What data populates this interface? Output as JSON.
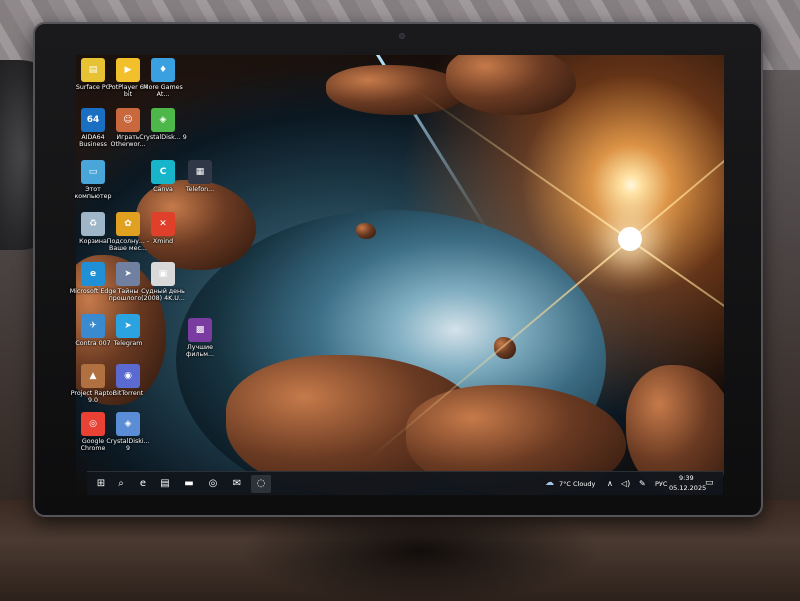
{
  "desktop_icons": [
    {
      "label": "Surface PC",
      "icon": "surface-pc-icon",
      "glyph": "▤",
      "color": "#e7c334"
    },
    {
      "label": "PotPlayer 64 bit",
      "icon": "potplayer-icon",
      "glyph": "▶",
      "color": "#f1c02a"
    },
    {
      "label": "More Games At...",
      "icon": "more-games-icon",
      "glyph": "♦",
      "color": "#3aa0e0"
    },
    {
      "label": "AIDA64 Business",
      "icon": "aida64-icon",
      "glyph": "64",
      "color": "#1a6fc2"
    },
    {
      "label": "Играть Otherwor...",
      "icon": "otherworld-game-icon",
      "glyph": "☺",
      "color": "#c8683c"
    },
    {
      "label": "CrystalDisk... 9",
      "icon": "crystaldisk-icon",
      "glyph": "◈",
      "color": "#4db74a"
    },
    {
      "label": "Этот компьютер",
      "icon": "this-pc-icon",
      "glyph": "▭",
      "color": "#4aa6d8"
    },
    {
      "label": "Canva",
      "icon": "canva-icon",
      "glyph": "C",
      "color": "#17b5c9"
    },
    {
      "label": "Telefon...",
      "icon": "telefon-icon",
      "glyph": "▦",
      "color": "#303848"
    },
    {
      "label": "Корзина",
      "icon": "recycle-bin-icon",
      "glyph": "♻",
      "color": "#9fb6c8"
    },
    {
      "label": "Подсолну... - Ваше мес...",
      "icon": "sunflower-icon",
      "glyph": "✿",
      "color": "#e0a020"
    },
    {
      "label": "Xmind",
      "icon": "xmind-icon",
      "glyph": "✕",
      "color": "#e0402a"
    },
    {
      "label": "Microsoft Edge",
      "icon": "edge-icon",
      "glyph": "e",
      "color": "#1f8fd6"
    },
    {
      "label": "Тайны прошлого...",
      "icon": "mystery-game-icon",
      "glyph": "➤",
      "color": "#7080a0"
    },
    {
      "label": "Судный день (2008) 4K.U...",
      "icon": "video-file-icon",
      "glyph": "▣",
      "color": "#d9d9d9"
    },
    {
      "label": "Contra 007",
      "icon": "contra-icon",
      "glyph": "✈",
      "color": "#3a8ad0"
    },
    {
      "label": "Telegram",
      "icon": "telegram-icon",
      "glyph": "➤",
      "color": "#2aa3e0"
    },
    {
      "label": "Лучшие фильм...",
      "icon": "films-folder-icon",
      "glyph": "▩",
      "color": "#7a3ca0"
    },
    {
      "label": "Project Raptor 9.0",
      "icon": "raptor-icon",
      "glyph": "▲",
      "color": "#b07040"
    },
    {
      "label": "BitTorrent",
      "icon": "bittorrent-icon",
      "glyph": "◉",
      "color": "#5a6ad0"
    },
    {
      "label": "Google Chrome",
      "icon": "chrome-icon",
      "glyph": "◎",
      "color": "#e94235"
    },
    {
      "label": "CrystalDiski... 9",
      "icon": "crystaldisk2-icon",
      "glyph": "◈",
      "color": "#5b8dd6"
    }
  ],
  "taskbar": {
    "weather": "7°C Cloudy",
    "language": "РУС",
    "time": "9:39",
    "date": "05.12.2025",
    "apps": [
      {
        "icon": "windows-start-icon",
        "glyph": "⊞"
      },
      {
        "icon": "search-icon",
        "glyph": "⌕"
      },
      {
        "icon": "edge-taskbar-icon",
        "glyph": "e"
      },
      {
        "icon": "store-icon",
        "glyph": "▤"
      },
      {
        "icon": "explorer-icon",
        "glyph": "▬"
      },
      {
        "icon": "chrome-taskbar-icon",
        "glyph": "◎"
      },
      {
        "icon": "mail-icon",
        "glyph": "✉"
      },
      {
        "icon": "app-active-icon",
        "glyph": "◌"
      }
    ]
  },
  "colors": {
    "taskbar_bg": "#12161c",
    "accent": "#f6a54a"
  }
}
